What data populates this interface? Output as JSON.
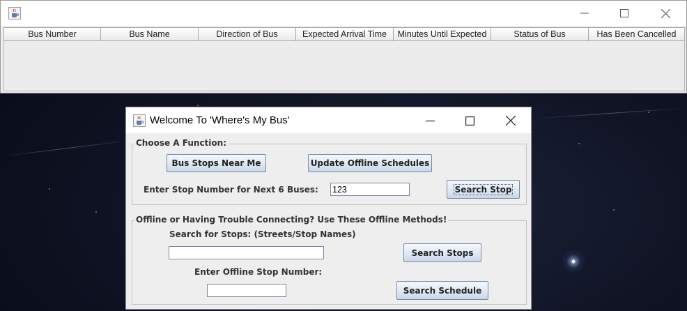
{
  "table_window": {
    "title": "",
    "icon": "java-cup-icon",
    "columns": [
      "Bus Number",
      "Bus Name",
      "Direction of Bus",
      "Expected Arrival Time",
      "Minutes Until Expected",
      "Status of Bus",
      "Has Been Cancelled"
    ],
    "rows": []
  },
  "main_window": {
    "title": "Welcome To 'Where's My Bus'",
    "icon": "java-cup-icon",
    "online_group": {
      "label": "Choose A Function:",
      "bus_stops_near_me": "Bus Stops Near Me",
      "update_offline": "Update Offline Schedules",
      "stop_number_label": "Enter Stop Number for Next 6 Buses:",
      "stop_number_value": "123",
      "search_stop": "Search Stop"
    },
    "offline_group": {
      "label": "Offline or Having Trouble Connecting? Use These Offline Methods!",
      "search_stops_label": "Search for Stops: (Streets/Stop Names)",
      "search_stops_value": "",
      "search_stops_button": "Search Stops",
      "offline_stop_label": "Enter Offline Stop Number:",
      "offline_stop_value": "",
      "search_schedule_button": "Search Schedule"
    }
  },
  "colors": {
    "window_bg": "#eeeeee",
    "titlebar_bg": "#ffffff",
    "desktop_bg": "#0e1222"
  }
}
